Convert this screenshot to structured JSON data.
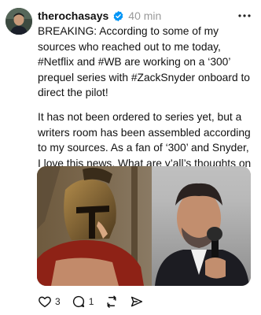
{
  "post": {
    "username": "therochasays",
    "timestamp": "40 min",
    "paragraphs": [
      "BREAKING: According to some of my sources who reached out to me today, #Netflix and #WB are working on a ‘300’ prequel series with #ZackSnyder  onboard to direct the pilot!",
      "It has not been ordered to series yet, but a writers room has been assembled according to my sources. As a fan of ‘300’ and Snyder, I love this news. What are y’all’s thoughts on this news???"
    ]
  },
  "actions": {
    "likes": "3",
    "replies": "1"
  },
  "colors": {
    "verified": "#0095f6",
    "muted": "#9a9a9a"
  },
  "icons": [
    "more-icon",
    "verified-badge-icon",
    "heart-icon",
    "comment-icon",
    "repost-icon",
    "share-icon"
  ]
}
